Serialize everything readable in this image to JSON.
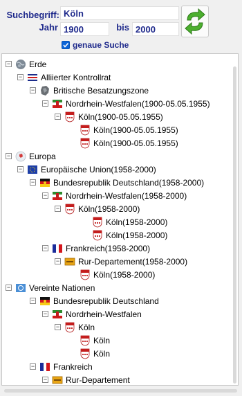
{
  "search": {
    "term_label": "Suchbegriff:",
    "term_value": "Köln",
    "year_label": "Jahr",
    "year_from": "1900",
    "bis_label": "bis",
    "year_to": "2000",
    "exact_checked": true,
    "exact_label": "genaue Suche",
    "swap_icon": "swap-arrows-icon"
  },
  "tree": {
    "rows": [
      {
        "label": "Erde",
        "icon": "globe-icon"
      },
      {
        "label": "Alliierter Kontrollrat",
        "icon": "allied-flag-icon"
      },
      {
        "label": "Britische Besatzungszone",
        "icon": "zone-map-icon"
      },
      {
        "label": "Nordrhein-Westfalen(1900-05.05.1955)",
        "icon": "nrw-flag-icon"
      },
      {
        "label": "Köln(1900-05.05.1955)",
        "icon": "koeln-crest-icon"
      },
      {
        "label": "Köln(1900-05.05.1955)",
        "icon": "koeln-crest-icon"
      },
      {
        "label": "Köln(1900-05.05.1955)",
        "icon": "koeln-crest-icon"
      },
      {
        "label": "Europa",
        "icon": "europe-globe-icon"
      },
      {
        "label": "Europäische Union(1958-2000)",
        "icon": "eu-flag-icon"
      },
      {
        "label": "Bundesrepublik Deutschland(1958-2000)",
        "icon": "germany-flag-icon"
      },
      {
        "label": "Nordrhein-Westfalen(1958-2000)",
        "icon": "nrw-flag-icon"
      },
      {
        "label": "Köln(1958-2000)",
        "icon": "koeln-crest-icon"
      },
      {
        "label": "Köln(1958-2000)",
        "icon": "koeln-crest-icon"
      },
      {
        "label": "Köln(1958-2000)",
        "icon": "koeln-crest-icon"
      },
      {
        "label": "Frankreich(1958-2000)",
        "icon": "france-flag-icon"
      },
      {
        "label": "Rur-Departement(1958-2000)",
        "icon": "rur-dept-icon"
      },
      {
        "label": "Köln(1958-2000)",
        "icon": "koeln-crest-icon"
      },
      {
        "label": "Vereinte Nationen",
        "icon": "un-flag-icon"
      },
      {
        "label": "Bundesrepublik Deutschland",
        "icon": "germany-flag-icon"
      },
      {
        "label": "Nordrhein-Westfalen",
        "icon": "nrw-flag-icon"
      },
      {
        "label": "Köln",
        "icon": "koeln-crest-icon"
      },
      {
        "label": "Köln",
        "icon": "koeln-crest-icon"
      },
      {
        "label": "Köln",
        "icon": "koeln-crest-icon"
      },
      {
        "label": "Frankreich",
        "icon": "france-flag-icon"
      },
      {
        "label": "Rur-Departement",
        "icon": "rur-dept-icon"
      }
    ]
  }
}
